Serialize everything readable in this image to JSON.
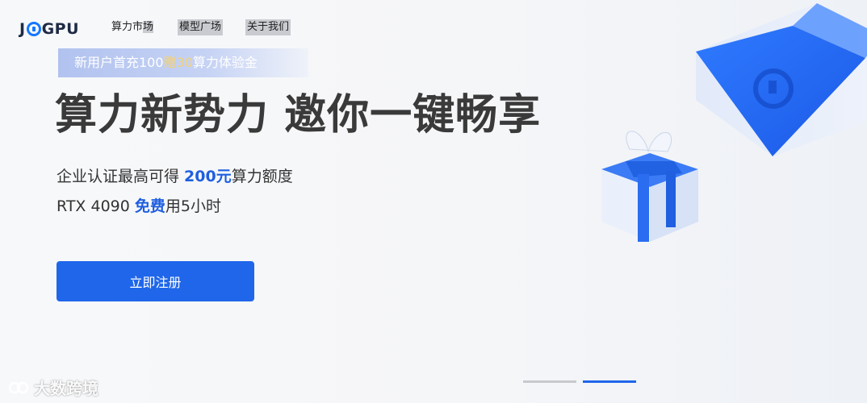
{
  "header": {
    "logo": {
      "prefix": "J",
      "suffix": "GPU"
    },
    "nav": [
      {
        "label_a": "算力市",
        "label_b": "场"
      },
      {
        "label": "模型广场"
      },
      {
        "label": "关于我们"
      }
    ]
  },
  "promo": {
    "text_a": "新用户首充100",
    "text_gold": "赠30",
    "text_b": "算力体验金"
  },
  "hero": {
    "headline": "算力新势力 邀你一键畅享",
    "line1_a": "企业认证最高可得 ",
    "line1_accent": "200元",
    "line1_b": "算力额度",
    "line2_a": "RTX 4090 ",
    "line2_accent": "免费",
    "line2_b": "用5小时",
    "cta": "立即注册"
  },
  "carousel": {
    "slides": 2,
    "active_index": 1
  },
  "watermark": {
    "text": "大数跨境",
    "icon": "brand-logo-icon"
  },
  "colors": {
    "accent": "#1f66ea",
    "gold": "#f3d27a",
    "headline": "#3a3a3a"
  }
}
